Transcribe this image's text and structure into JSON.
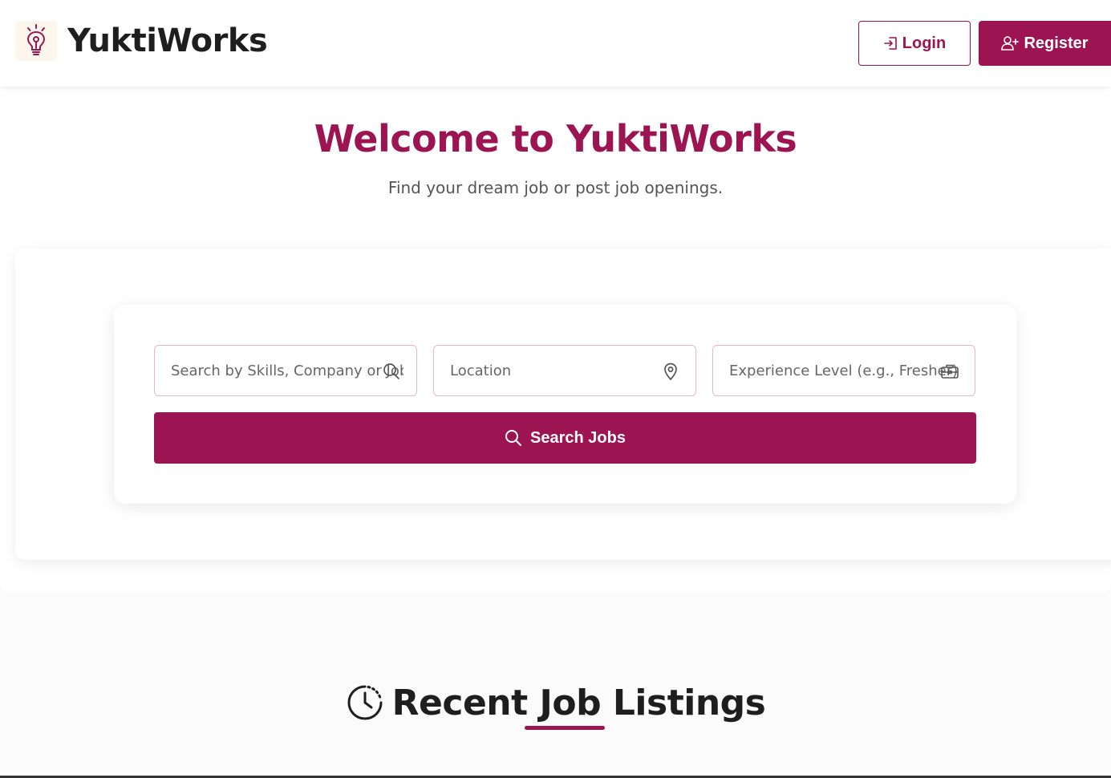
{
  "header": {
    "brand": "YuktiWorks",
    "login_label": "Login",
    "register_label": "Register"
  },
  "hero": {
    "title": "Welcome to YuktiWorks",
    "subtitle": "Find your dream job or post job openings."
  },
  "search": {
    "keyword_placeholder": "Search by Skills, Company or Job Title",
    "location_placeholder": "Location",
    "experience_placeholder": "Experience Level (e.g., Fresher)",
    "button_label": "Search Jobs"
  },
  "recent": {
    "title": "Recent Job Listings"
  },
  "colors": {
    "accent": "#9c1552",
    "field_border": "#e8b9cc"
  },
  "icons": [
    "lightbulb-icon",
    "login-icon",
    "add-user-icon",
    "search-icon",
    "location-pin-icon",
    "briefcase-icon",
    "clock-icon"
  ]
}
